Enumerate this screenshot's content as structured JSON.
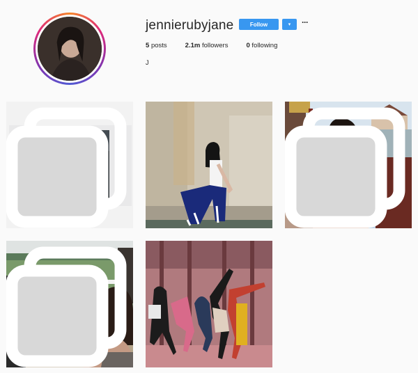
{
  "profile": {
    "username": "jennierubyjane",
    "follow_label": "Follow",
    "dropdown_icon": "chevron-down-icon",
    "more_icon": "ellipsis-icon",
    "posts_count": "5",
    "posts_label": "posts",
    "followers_count": "2.1m",
    "followers_label": "followers",
    "following_count": "0",
    "following_label": "following",
    "bio": "J"
  },
  "posts": [
    {
      "name": "post-polaroid",
      "multi": true
    },
    {
      "name": "post-wall-portrait",
      "multi": false
    },
    {
      "name": "post-carousel-ride",
      "multi": true
    },
    {
      "name": "post-racecourse",
      "multi": true
    },
    {
      "name": "post-group-dance",
      "multi": false
    }
  ],
  "colors": {
    "accent": "#3897f0",
    "background": "#fafafa",
    "text": "#262626"
  }
}
